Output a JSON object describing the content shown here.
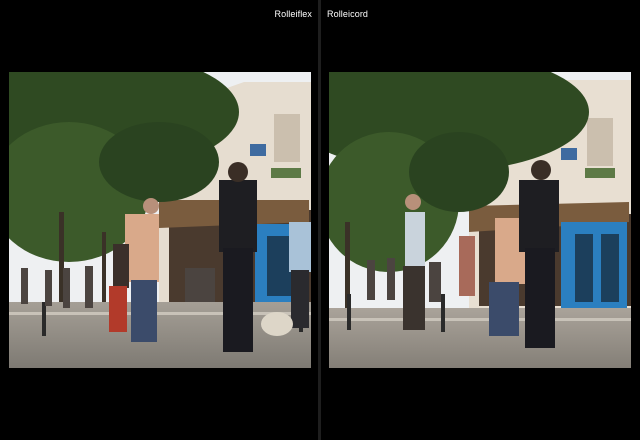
{
  "panels": [
    {
      "label": "Rolleiflex"
    },
    {
      "label": "Rolleicord"
    }
  ],
  "colors": {
    "background": "#000000",
    "label_text": "#ffffff",
    "sky": "#eef0f2",
    "building": "#e6ddd0",
    "foliage": "#2f4a22",
    "pavement": "#8f8a82",
    "cafe_blue": "#2b7fc0"
  }
}
